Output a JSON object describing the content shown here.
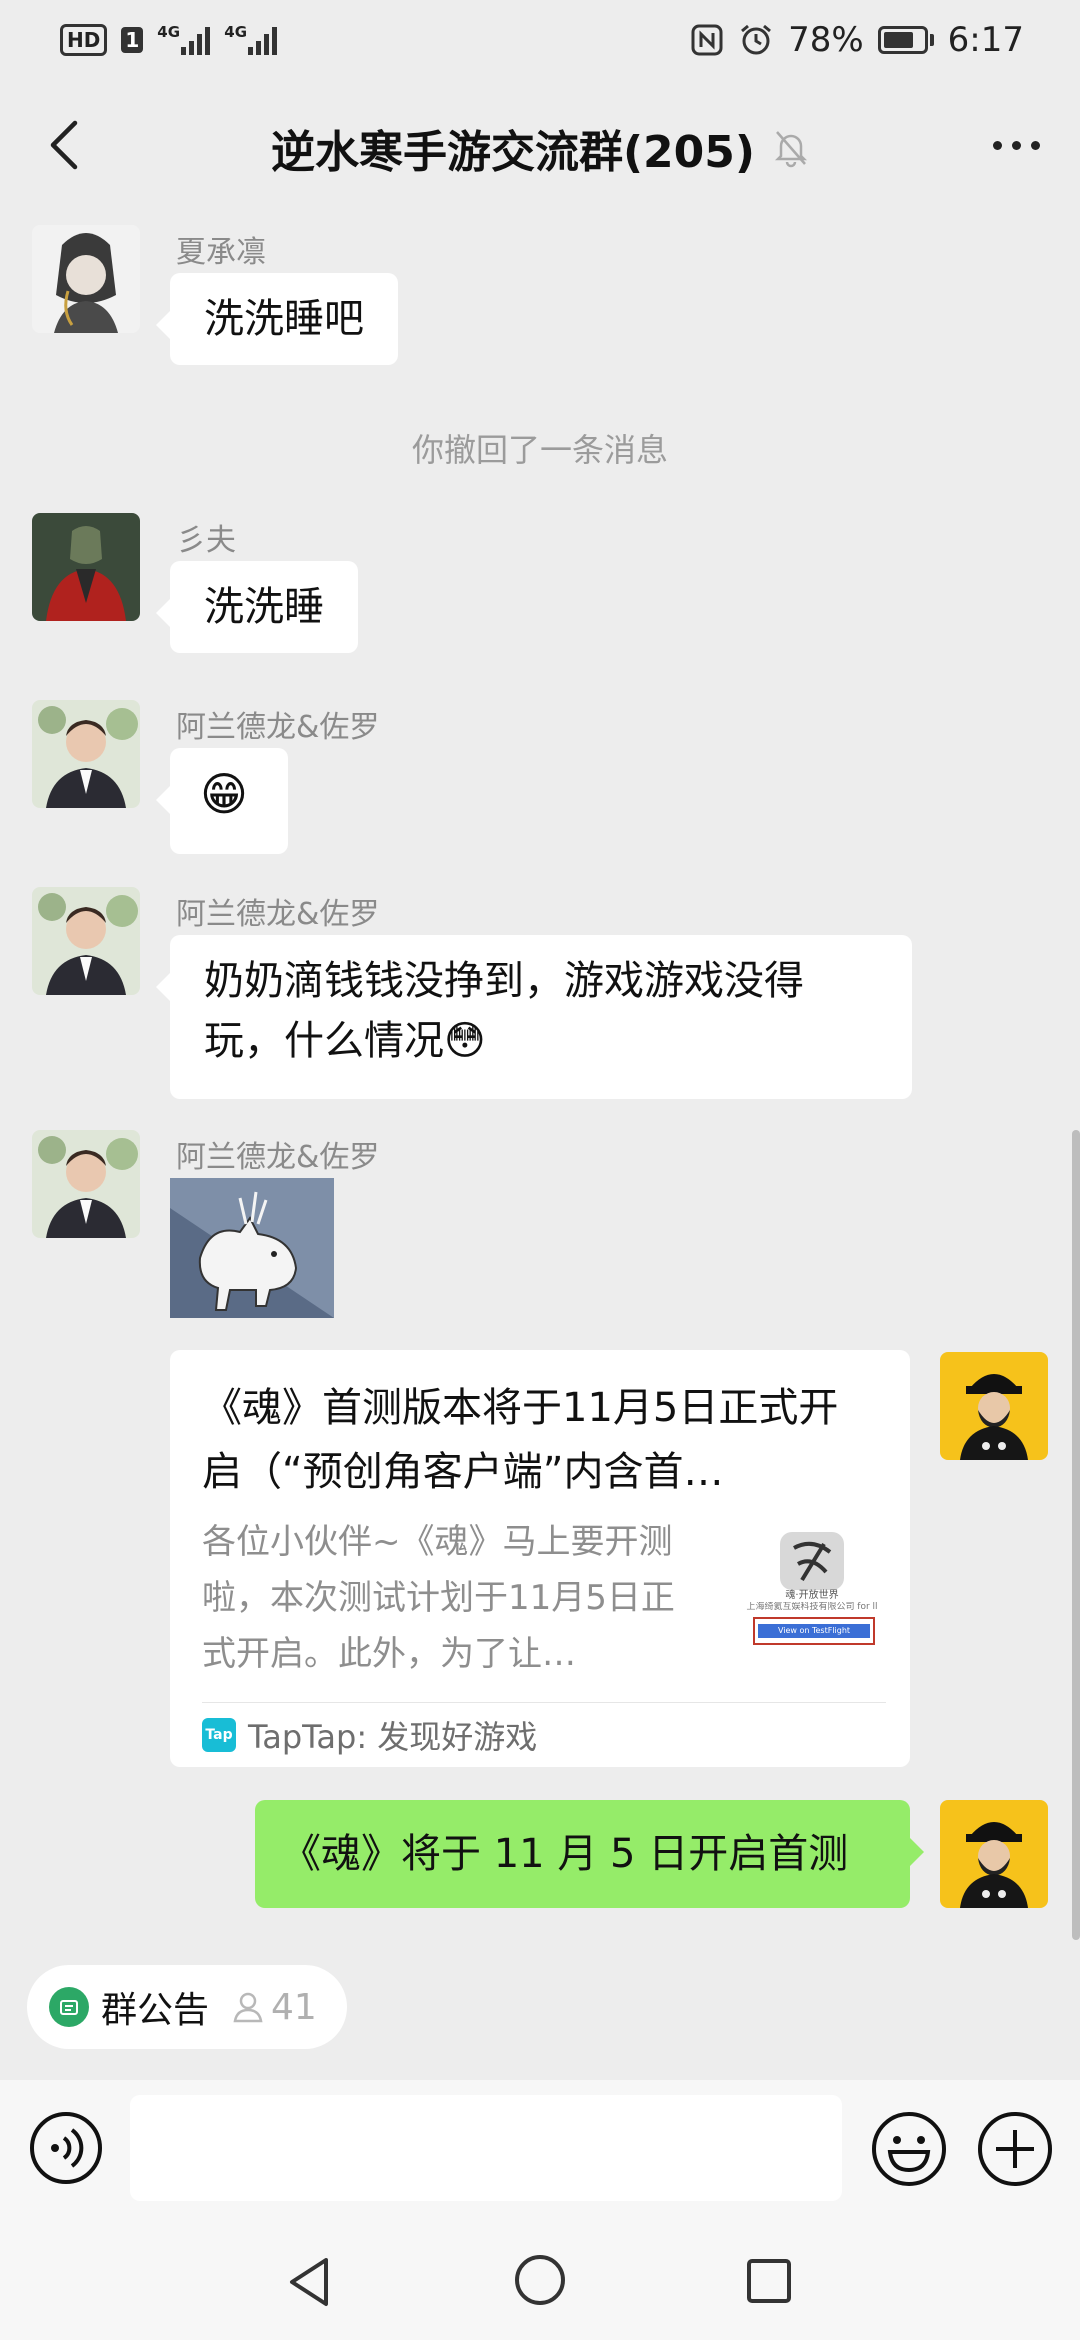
{
  "status_bar": {
    "hd": "HD",
    "sim": "1",
    "net1": "4G",
    "net2": "4G",
    "battery": "78%",
    "time": "6:17",
    "battery_level": 0.78
  },
  "header": {
    "title": "逆水寒手游交流群(205)"
  },
  "messages": {
    "m1": {
      "sender": "夏承凛",
      "text": "洗洗睡吧"
    },
    "recall": "你撤回了一条消息",
    "m2": {
      "sender": "彡夫",
      "text": "洗洗睡"
    },
    "m3": {
      "sender": "阿兰德龙&佐罗",
      "text": "😁"
    },
    "m4": {
      "sender": "阿兰德龙&佐罗",
      "text": "奶奶滴钱钱没挣到，游戏游戏没得玩，什么情况😳"
    },
    "m5": {
      "sender": "阿兰德龙&佐罗"
    },
    "card": {
      "title": "《魂》首测版本将于11月5日正式开启（“预创角客户端”内含首…",
      "desc": "各位小伙伴~《魂》马上要开测啦，本次测试计划于11月5日正式开启。此外，为了让…",
      "source_icon": "Tap",
      "source": "TapTap: 发现好游戏",
      "thumb_text1": "魂·开放世界",
      "thumb_text2": "上海绮氦互娱科技有限公司 for ll",
      "thumb_button": "View on TestFlight"
    },
    "m6": {
      "text": "《魂》将于 11 月 5 日开启首测"
    }
  },
  "announcement": {
    "label": "群公告",
    "count": "41"
  },
  "input": {
    "placeholder": ""
  },
  "colors": {
    "background": "#ededed",
    "my_bubble": "#95ec69",
    "their_bubble": "#ffffff",
    "announce_icon": "#2ca866"
  }
}
